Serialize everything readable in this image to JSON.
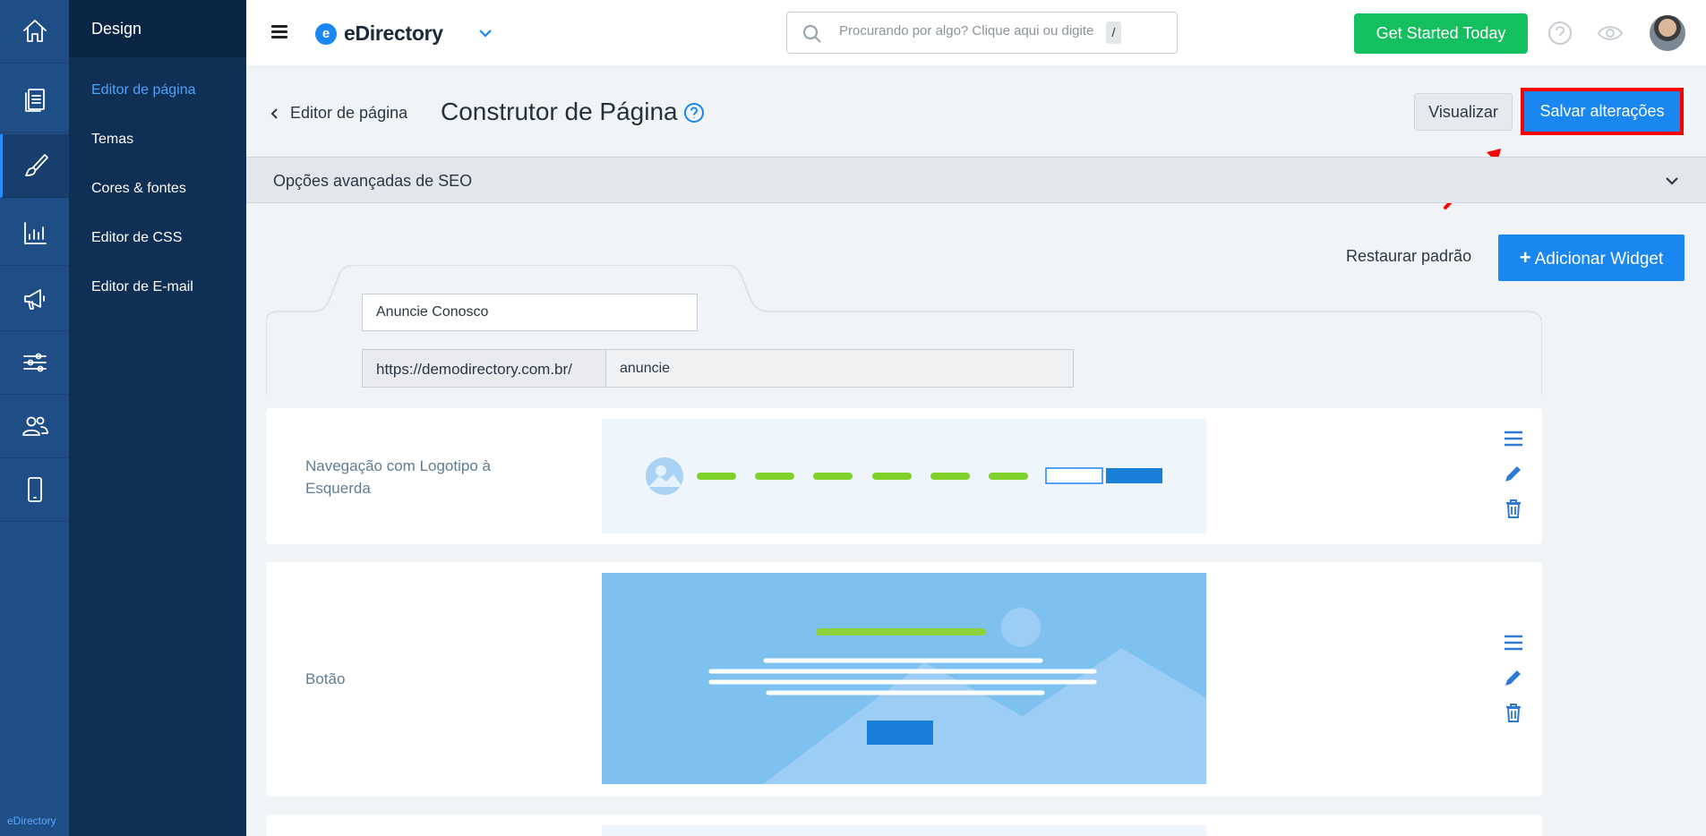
{
  "rail": {
    "items": [
      "home",
      "pages",
      "design",
      "reports",
      "promote",
      "settings",
      "users",
      "mobile"
    ],
    "brand": "eDirectory"
  },
  "submenu": {
    "title": "Design",
    "items": [
      {
        "label": "Editor de página",
        "active": true
      },
      {
        "label": "Temas"
      },
      {
        "label": "Cores & fontes"
      },
      {
        "label": "Editor de CSS"
      },
      {
        "label": "Editor de E-mail"
      }
    ]
  },
  "topbar": {
    "logo_text": "eDirectory",
    "logo_mark": "e",
    "search_placeholder": "Procurando por algo? Clique aqui ou digite",
    "search_key": "/",
    "cta_label": "Get Started Today"
  },
  "header": {
    "back_label": "Editor de página",
    "title": "Construtor de Página",
    "preview_label": "Visualizar",
    "save_label": "Salvar alterações"
  },
  "seo": {
    "label": "Opções avançadas de SEO"
  },
  "toolbar": {
    "restore_label": "Restaurar padrão",
    "add_widget_label": "Adicionar Widget",
    "add_icon": "+"
  },
  "page_form": {
    "name_value": "Anuncie Conosco",
    "url_prefix": "https://demodirectory.com.br/",
    "url_value": "anuncie"
  },
  "widgets": [
    {
      "name": "Navegação com Logotipo à Esquerda"
    },
    {
      "name": "Botão"
    }
  ],
  "colors": {
    "accent": "#1a86f0",
    "cta": "#13bf5e",
    "highlight": "#ff0000",
    "rail": "#1f4e86",
    "submenu": "#0f2f55"
  }
}
